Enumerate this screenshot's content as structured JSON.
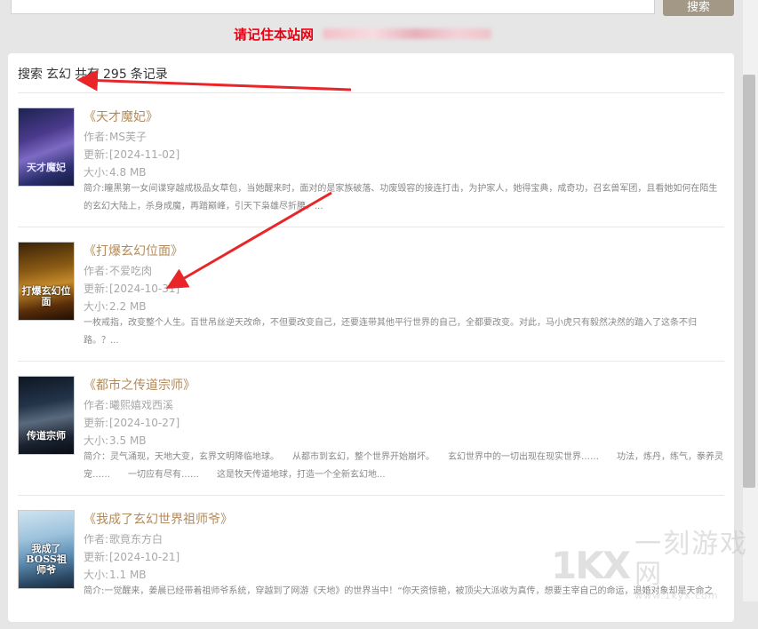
{
  "search": {
    "button_label": "搜索"
  },
  "notice": {
    "text": "请记住本站网"
  },
  "results": {
    "summary_parts": [
      "搜索",
      "玄幻",
      "共有",
      "295",
      "条记录"
    ],
    "meta_labels": {
      "author": "作者:",
      "updated": "更新:",
      "size": "大小:",
      "intro": "简介:"
    },
    "books": [
      {
        "title": "《天才魔妃》",
        "author": "MS芙子",
        "updated": "[2024-11-02]",
        "size": "4.8 MB",
        "intro": "瞳黑第一女间谍穿越成极品女草包，当她醒来时，面对的是家族破落、功废毁容的接连打击，为护家人，她得宝典，成奇功，召玄兽军团，且看她如何在陌生的玄幻大陆上，杀身成魔，再踏巅峰，引天下枭雄尽折腰。...",
        "cover_text": "天才魔妃"
      },
      {
        "title": "《打爆玄幻位面》",
        "author": "不爱吃肉",
        "updated": "[2024-10-31]",
        "size": "2.2 MB",
        "intro": "一枚戒指，改变整个人生。百世吊丝逆天改命，不但要改变自己，还要连带其他平行世界的自己，全都要改变。对此，马小虎只有毅然决然的踏入了这条不归路。？...",
        "cover_text": "打爆玄幻位面"
      },
      {
        "title": "《都市之传道宗师》",
        "author": "曦熙嬉戏西溪",
        "updated": "[2024-10-27]",
        "size": "3.5 MB",
        "intro": "简介：灵气涌现，天地大变，玄界文明降临地球。　　从都市到玄幻，整个世界开始崩坏。　　玄幻世界中的一切出现在现实世界……　　功法，炼丹，练气，豢养灵宠……　　一切应有尽有……　　这是牧天传道地球，打造一个全新玄幻地...",
        "cover_text": "传道宗师"
      },
      {
        "title": "《我成了玄幻世界祖师爷》",
        "author": "歌竟东方白",
        "updated": "[2024-10-21]",
        "size": "1.1 MB",
        "intro": "一觉醒来，姜晨已经带着祖师爷系统，穿越到了网游《天地》的世界当中！“你天资惊艳，被顶尖大派收为真传，想要主宰自己的命运，退婚对象却是天命之",
        "cover_text": "我成了BOSS祖师爷"
      }
    ]
  },
  "watermark": {
    "logo": "1KX",
    "name": "一刻游戏网",
    "url": "www.1kyx.com"
  },
  "colors": {
    "notice_red": "#e60012",
    "title_gold": "#b38b5a",
    "meta_gray": "#a8a8a8",
    "annotation_arrow": "#e8262a",
    "button_bg": "#a39886"
  }
}
